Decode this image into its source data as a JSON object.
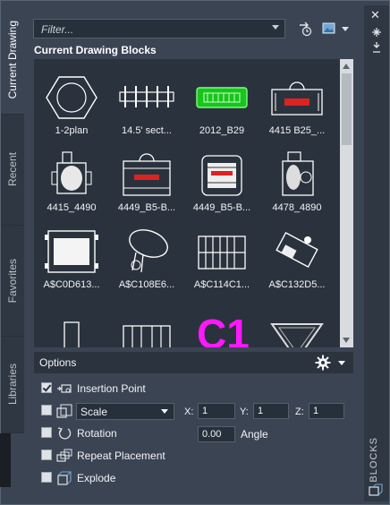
{
  "tabs": [
    "Current Drawing",
    "Recent",
    "Favorites",
    "Libraries"
  ],
  "active_tab": "Current Drawing",
  "filter": {
    "placeholder": "Filter..."
  },
  "section_title": "Current Drawing Blocks",
  "blocks": [
    {
      "name": "1-2plan",
      "icon": "hexagon-block-icon"
    },
    {
      "name": "14.5' sect...",
      "icon": "rail-section-icon"
    },
    {
      "name": "2012_B29",
      "icon": "green-board-icon"
    },
    {
      "name": "4415 B25_...",
      "icon": "machine-block-icon"
    },
    {
      "name": "4415_4490",
      "icon": "motor-block-icon"
    },
    {
      "name": "4449_B5-B...",
      "icon": "machine-block-icon"
    },
    {
      "name": "4449_B5-B...",
      "icon": "machine-block-icon"
    },
    {
      "name": "4478_4890",
      "icon": "motor-block-icon"
    },
    {
      "name": "A$C0D613...",
      "icon": "panel-block-icon"
    },
    {
      "name": "A$C108E6...",
      "icon": "pump-block-icon"
    },
    {
      "name": "A$C114C1...",
      "icon": "frame-block-icon"
    },
    {
      "name": "A$C132D5...",
      "icon": "equipment-block-icon"
    },
    {
      "name": "",
      "icon": "column-block-icon"
    },
    {
      "name": "",
      "icon": "frame-block-icon"
    },
    {
      "name": "C1",
      "icon": "text-c1-icon"
    },
    {
      "name": "",
      "icon": "triangle-block-icon"
    }
  ],
  "options": {
    "title": "Options",
    "insertion_point": {
      "label": "Insertion Point",
      "checked": true
    },
    "scale": {
      "checked": false,
      "selected": "Scale",
      "x_label": "X:",
      "x": "1",
      "y_label": "Y:",
      "y": "1",
      "z_label": "Z:",
      "z": "1"
    },
    "rotation": {
      "label": "Rotation",
      "checked": false,
      "angle": "0.00",
      "angle_label": "Angle"
    },
    "repeat_placement": {
      "label": "Repeat Placement",
      "checked": false
    },
    "explode": {
      "label": "Explode",
      "checked": false
    }
  },
  "palette_title": "BLOCKS"
}
